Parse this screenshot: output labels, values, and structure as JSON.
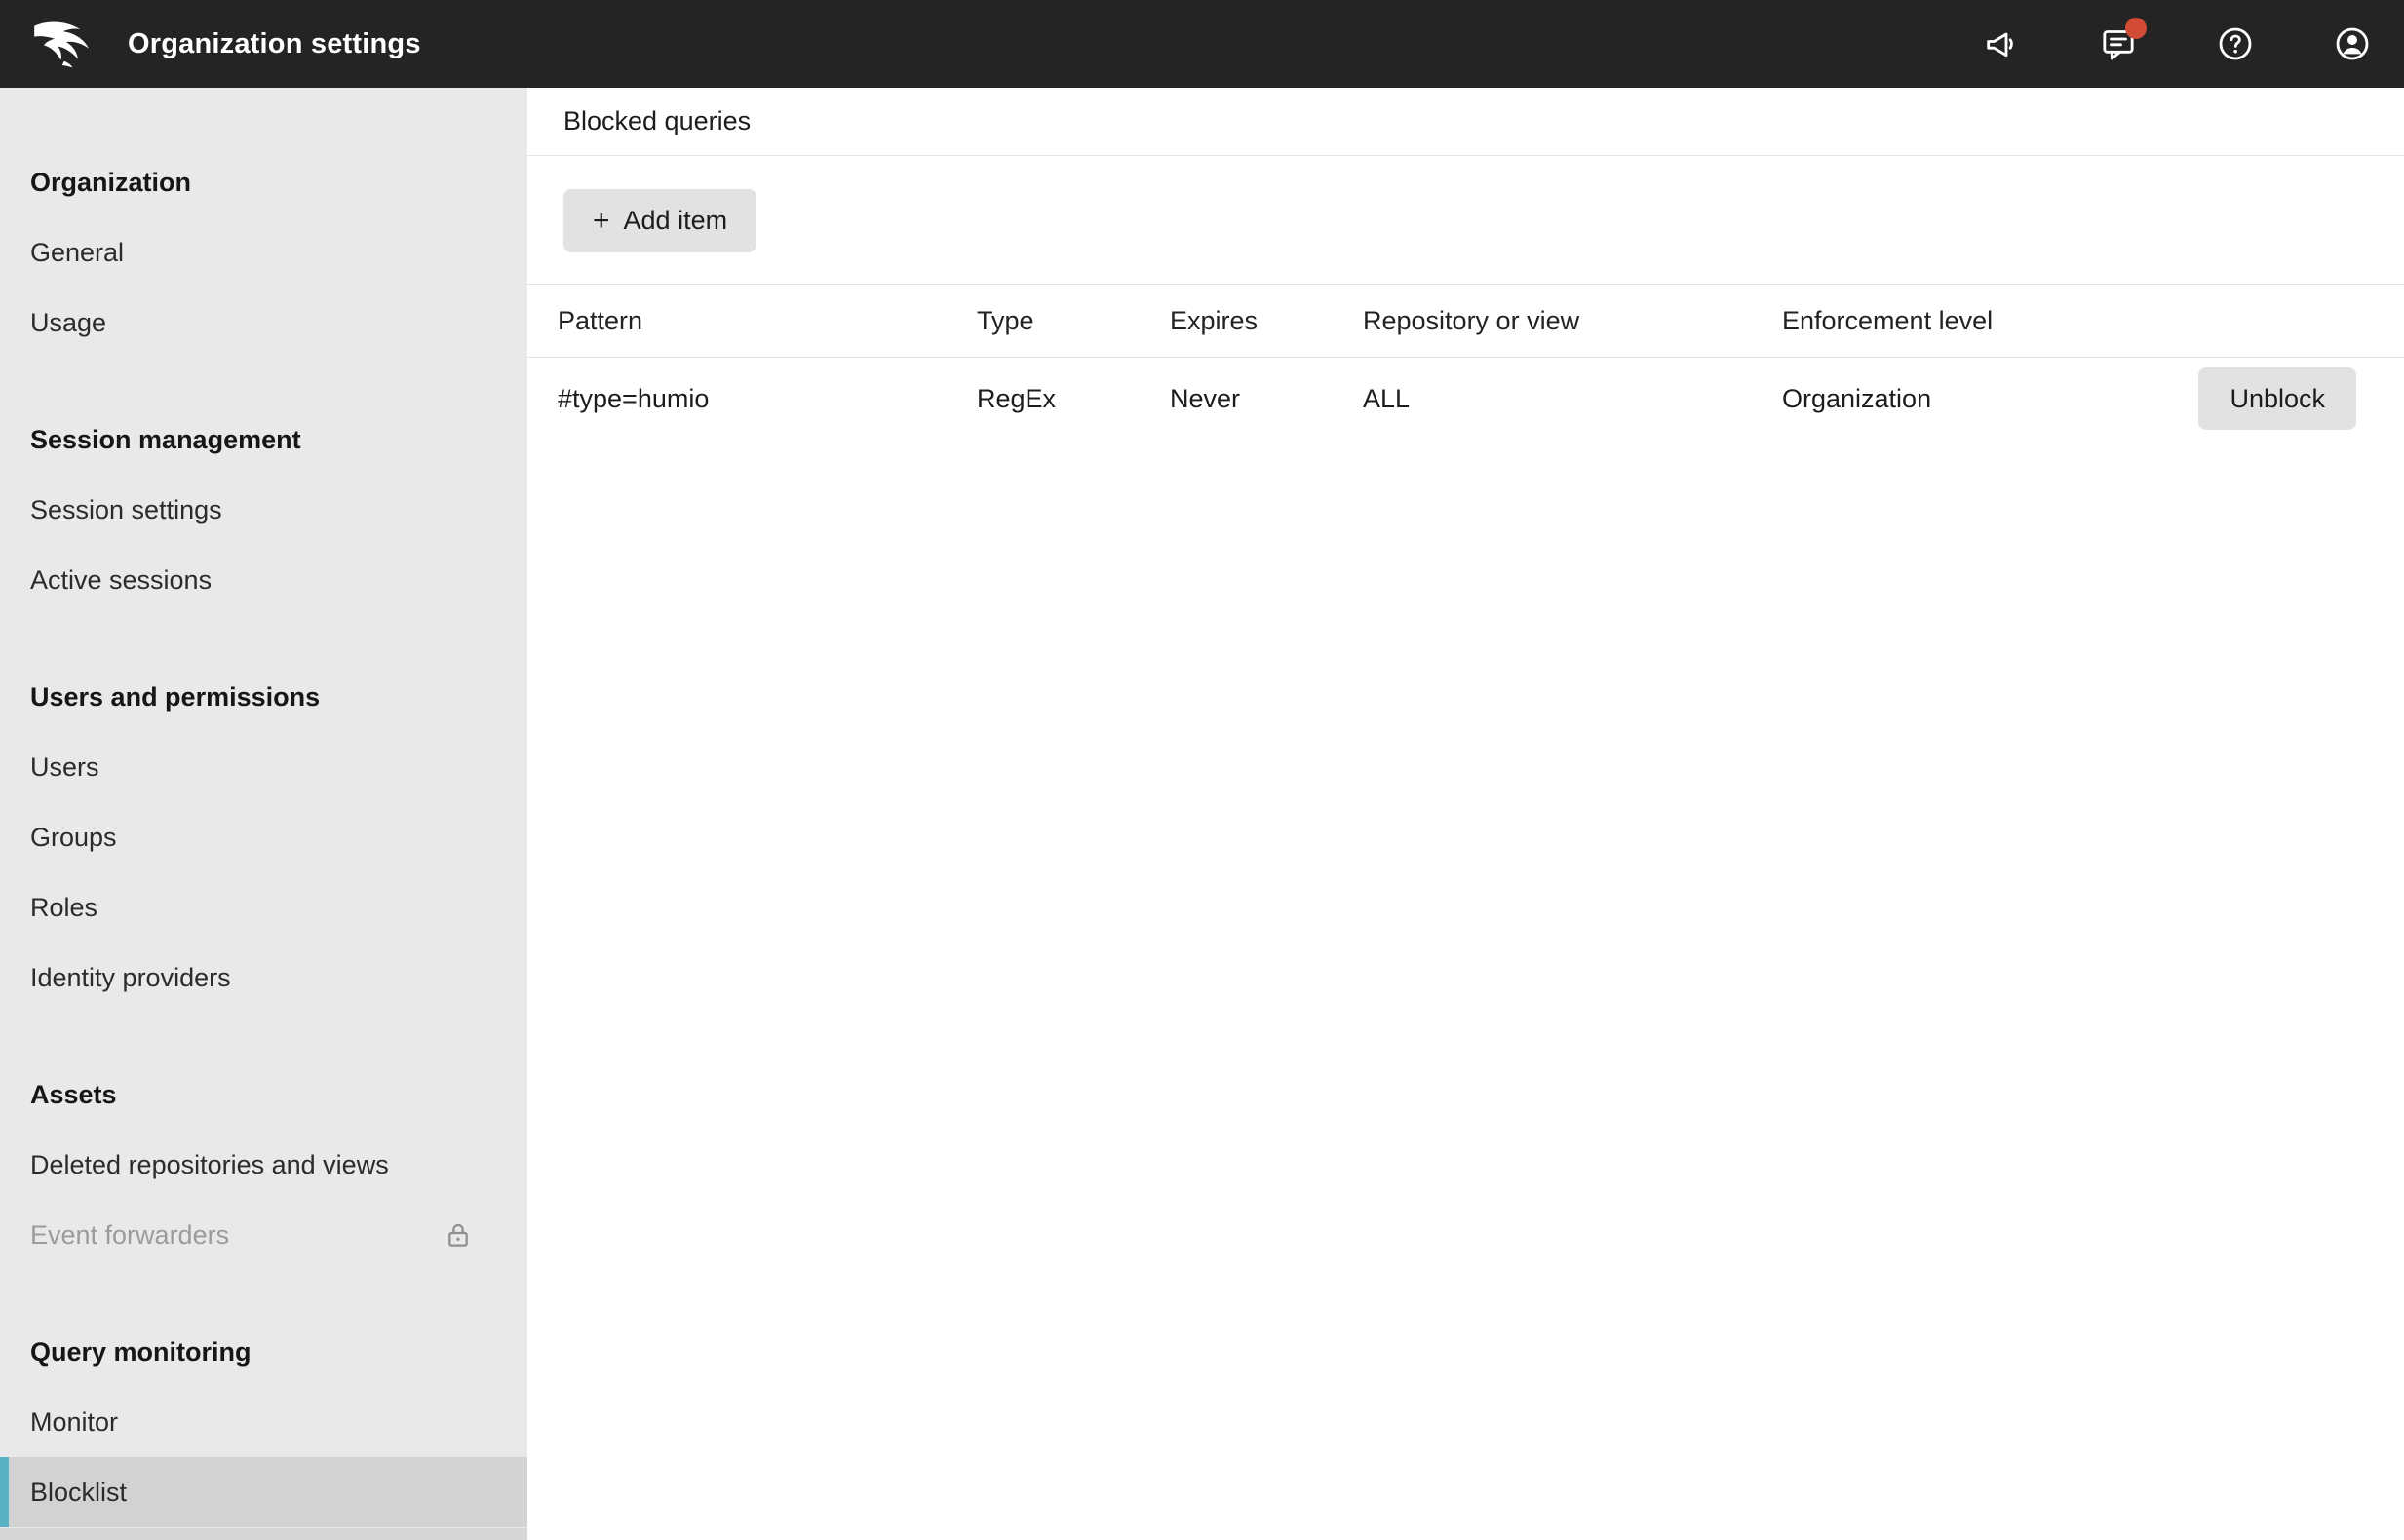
{
  "topbar": {
    "title": "Organization settings",
    "icons": {
      "announcement": "announcement-megaphone",
      "feedback": "feedback-chat-with-notification",
      "help": "help-question-circle",
      "account": "account-user-circle"
    },
    "notification_dot_color": "#d24b35",
    "background_color": "#242424"
  },
  "sidebar": {
    "selected_color": "#58b2c4",
    "sections": [
      {
        "heading": "Organization",
        "items": [
          {
            "label": "General"
          },
          {
            "label": "Usage"
          }
        ]
      },
      {
        "heading": "Session management",
        "items": [
          {
            "label": "Session settings"
          },
          {
            "label": "Active sessions"
          }
        ]
      },
      {
        "heading": "Users and permissions",
        "items": [
          {
            "label": "Users"
          },
          {
            "label": "Groups"
          },
          {
            "label": "Roles"
          },
          {
            "label": "Identity providers"
          }
        ]
      },
      {
        "heading": "Assets",
        "items": [
          {
            "label": "Deleted repositories and views"
          },
          {
            "label": "Event forwarders",
            "locked": true
          }
        ]
      },
      {
        "heading": "Query monitoring",
        "items": [
          {
            "label": "Monitor"
          },
          {
            "label": "Blocklist",
            "selected": true
          }
        ]
      }
    ]
  },
  "main": {
    "title": "Blocked queries",
    "add_button": {
      "plus_icon": "+",
      "label": "Add item"
    },
    "table": {
      "headers": [
        "Pattern",
        "Type",
        "Expires",
        "Repository or view",
        "Enforcement level"
      ],
      "rows": [
        {
          "pattern": "#type=humio",
          "type": "RegEx",
          "expires": "Never",
          "repository": "ALL",
          "enforcement": "Organization",
          "action": "Unblock"
        }
      ]
    }
  }
}
